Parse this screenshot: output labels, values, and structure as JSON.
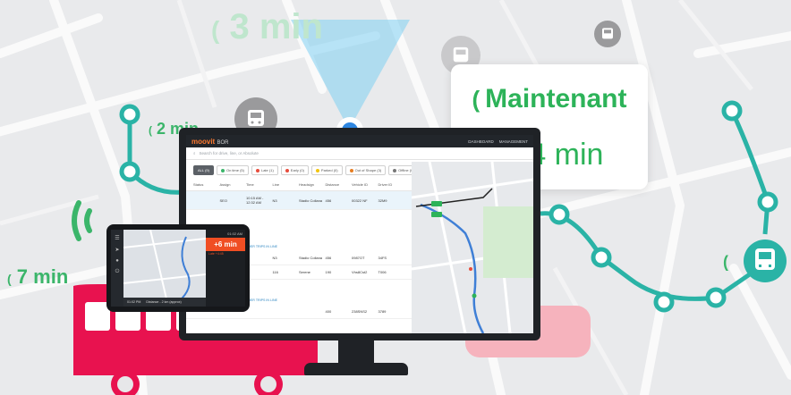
{
  "etas": {
    "top_faded": "3 min",
    "left_upper": "2 min",
    "left_lower": "7 min"
  },
  "card": {
    "status": "Maintenant",
    "times": "1, 4 min"
  },
  "dashboard": {
    "brand": "moovit",
    "brand_suffix": "BOR",
    "nav": [
      "DASHBOARD",
      "MANAGEMENT"
    ],
    "search_placeholder": "Search for drive, line, or Absolute",
    "filters": [
      {
        "label": "ALL (9)",
        "active": true,
        "color": ""
      },
      {
        "label": "On time (5)",
        "active": false,
        "color": "#3bb56a"
      },
      {
        "label": "Late (1)",
        "active": false,
        "color": "#e74c3c"
      },
      {
        "label": "Early (0)",
        "active": false,
        "color": "#e74c3c"
      },
      {
        "label": "Parked (0)",
        "active": false,
        "color": "#f1c40f"
      },
      {
        "label": "Out of Shape (3)",
        "active": false,
        "color": "#e67e22"
      },
      {
        "label": "Offline (0)",
        "active": false,
        "color": "#777777"
      }
    ],
    "columns": [
      "Status",
      "Assign",
      "Time",
      "Line",
      "Headsign",
      "Distance",
      "Vehicle ID",
      "Driver ID"
    ],
    "rows": [
      [
        "",
        "SEO",
        "10:15 AM - 12:32 AM",
        "N3",
        "Stadio Collana",
        "456",
        "00322 NF",
        "32M9"
      ],
      [
        "",
        "",
        "",
        "N3",
        "Stadio Collana",
        "456",
        "0987OT",
        "34FS"
      ],
      [
        "",
        "",
        "",
        "116",
        "Serene",
        "190",
        "Vhs8Cst2",
        "T006"
      ],
      [
        "",
        "",
        "",
        "",
        "",
        "400",
        "238SNS2",
        "3789"
      ]
    ],
    "show_other": "HIDE OTHER TRIPS IN LINE",
    "show_other_2": "SHOW OTHER TRIPS IN LINE"
  },
  "tablet": {
    "clock": "01:02 AM",
    "late": "+6 min",
    "line_info": "Late +4:45",
    "bottom_time": "01:02 PM",
    "bottom_info": "Distance - 2 km (approx)"
  },
  "colors": {
    "green": "#2db359",
    "teal_route": "#2ab3a6",
    "bus_red": "#e8124f",
    "bus_pink": "#f6b3bd"
  }
}
